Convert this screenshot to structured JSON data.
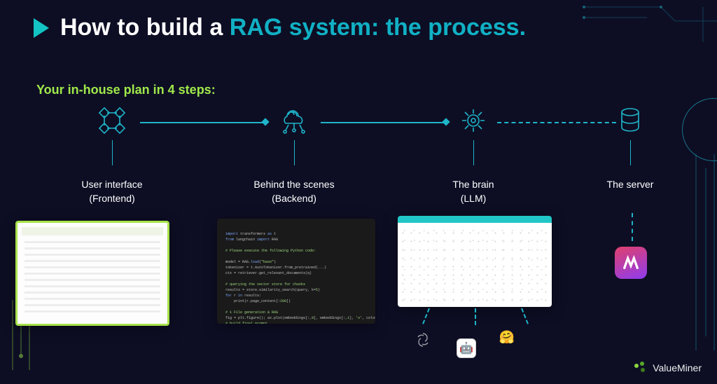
{
  "title": {
    "prefix": "How to build a ",
    "accent": "RAG system: the process."
  },
  "subtitle": "Your in-house plan in 4 steps:",
  "steps": [
    {
      "icon": "nodes-icon",
      "title": "User interface",
      "sub": "(Frontend)"
    },
    {
      "icon": "cloud-network-icon",
      "title": "Behind the scenes",
      "sub": "(Backend)"
    },
    {
      "icon": "gear-icon",
      "title": "The brain",
      "sub": "(LLM)"
    },
    {
      "icon": "database-icon",
      "title": "The server",
      "sub": ""
    }
  ],
  "llm_providers": [
    {
      "name": "openai",
      "glyph": "⌘"
    },
    {
      "name": "custom-robot",
      "glyph": "🤖"
    },
    {
      "name": "huggingface",
      "glyph": "🤗"
    }
  ],
  "server_app": {
    "name": "app-icon",
    "letter": "M"
  },
  "brand": "ValueMiner",
  "colors": {
    "accent_cyan": "#1fb5c9",
    "accent_green": "#a0e84a",
    "bg": "#0d0e24"
  }
}
